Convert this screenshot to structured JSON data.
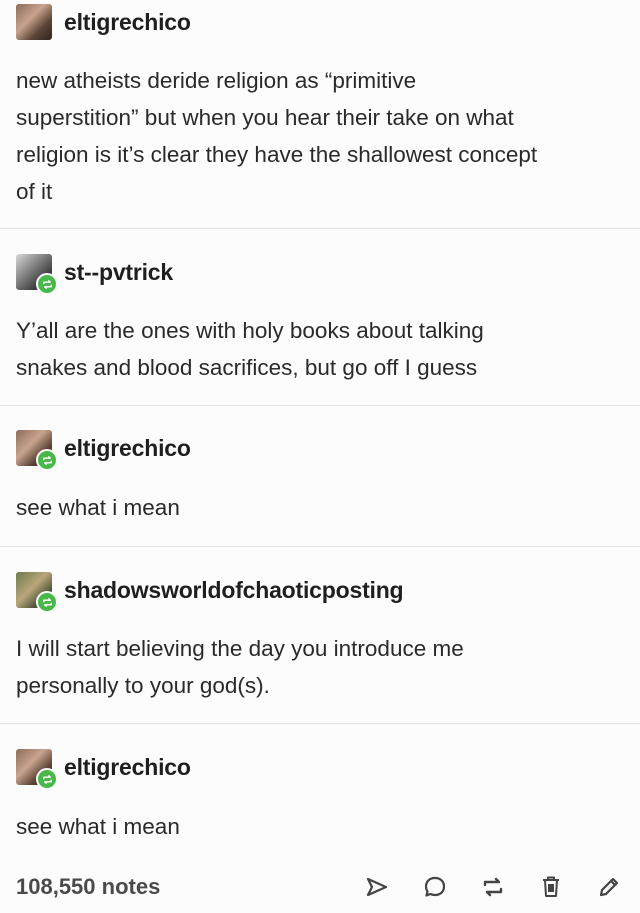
{
  "posts": [
    {
      "username": "eltigrechico",
      "text_lines": [
        "new atheists deride religion as “primitive",
        "superstition” but when you hear their take on what",
        "religion is it’s clear they have the shallowest concept",
        "of it"
      ]
    },
    {
      "username": "st--pvtrick",
      "text_lines": [
        "Y’all are the ones with holy books about talking",
        "snakes and blood sacrifices, but go off I guess"
      ]
    },
    {
      "username": "eltigrechico",
      "text_lines": [
        "see what i mean"
      ]
    },
    {
      "username": "shadowsworldofchaoticposting",
      "text_lines": [
        "I will start believing the day you introduce me",
        "personally to your god(s)."
      ]
    },
    {
      "username": "eltigrechico",
      "text_lines": [
        "see what i mean"
      ]
    }
  ],
  "footer": {
    "notes": "108,550 notes"
  },
  "colors": {
    "reblog_badge": "#48b84a",
    "divider": "#e3e3e3",
    "text": "#2a2a2a"
  },
  "icons": [
    "send-icon",
    "reply-icon",
    "reblog-icon",
    "delete-icon",
    "edit-icon"
  ]
}
